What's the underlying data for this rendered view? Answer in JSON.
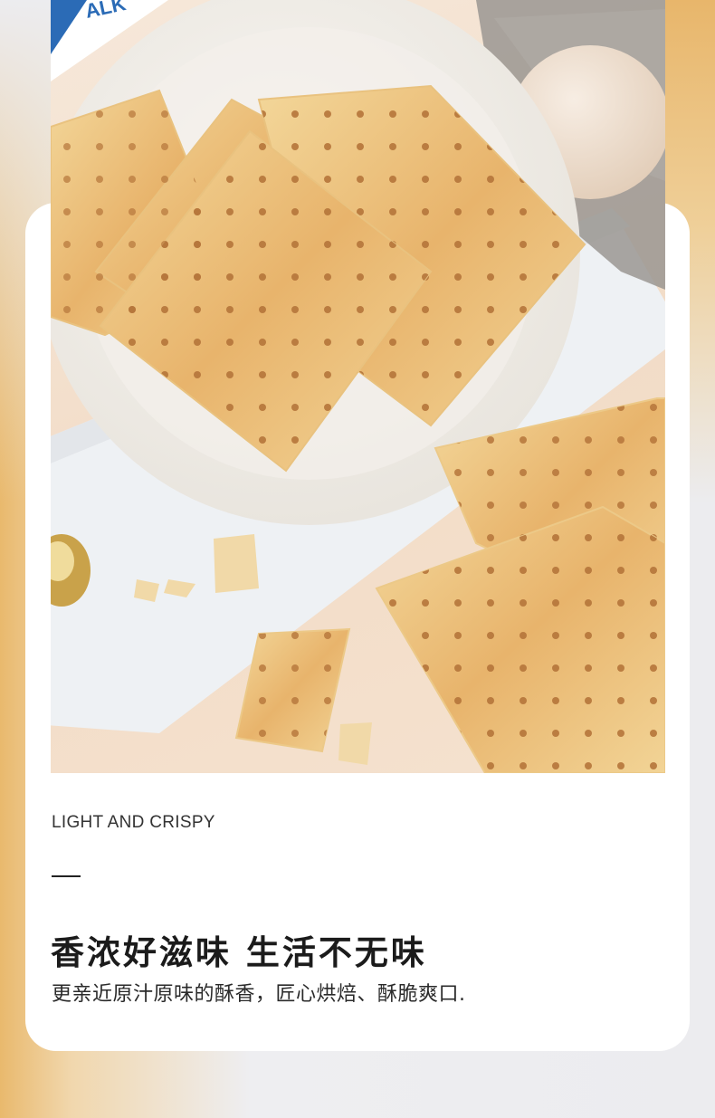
{
  "photo": {
    "package_text": "ALK"
  },
  "caption": {
    "english": "LIGHT AND CRISPY",
    "title": "香浓好滋味 生活不无味",
    "subtitle": "更亲近原汁原味的酥香，匠心烘焙、酥脆爽口."
  },
  "colors": {
    "cracker": "#f0cf8e",
    "cracker_toast": "#e3a65a",
    "plate": "#f4f1ec",
    "board": "#f2f3f5",
    "background_gold": "#e9b96d"
  }
}
